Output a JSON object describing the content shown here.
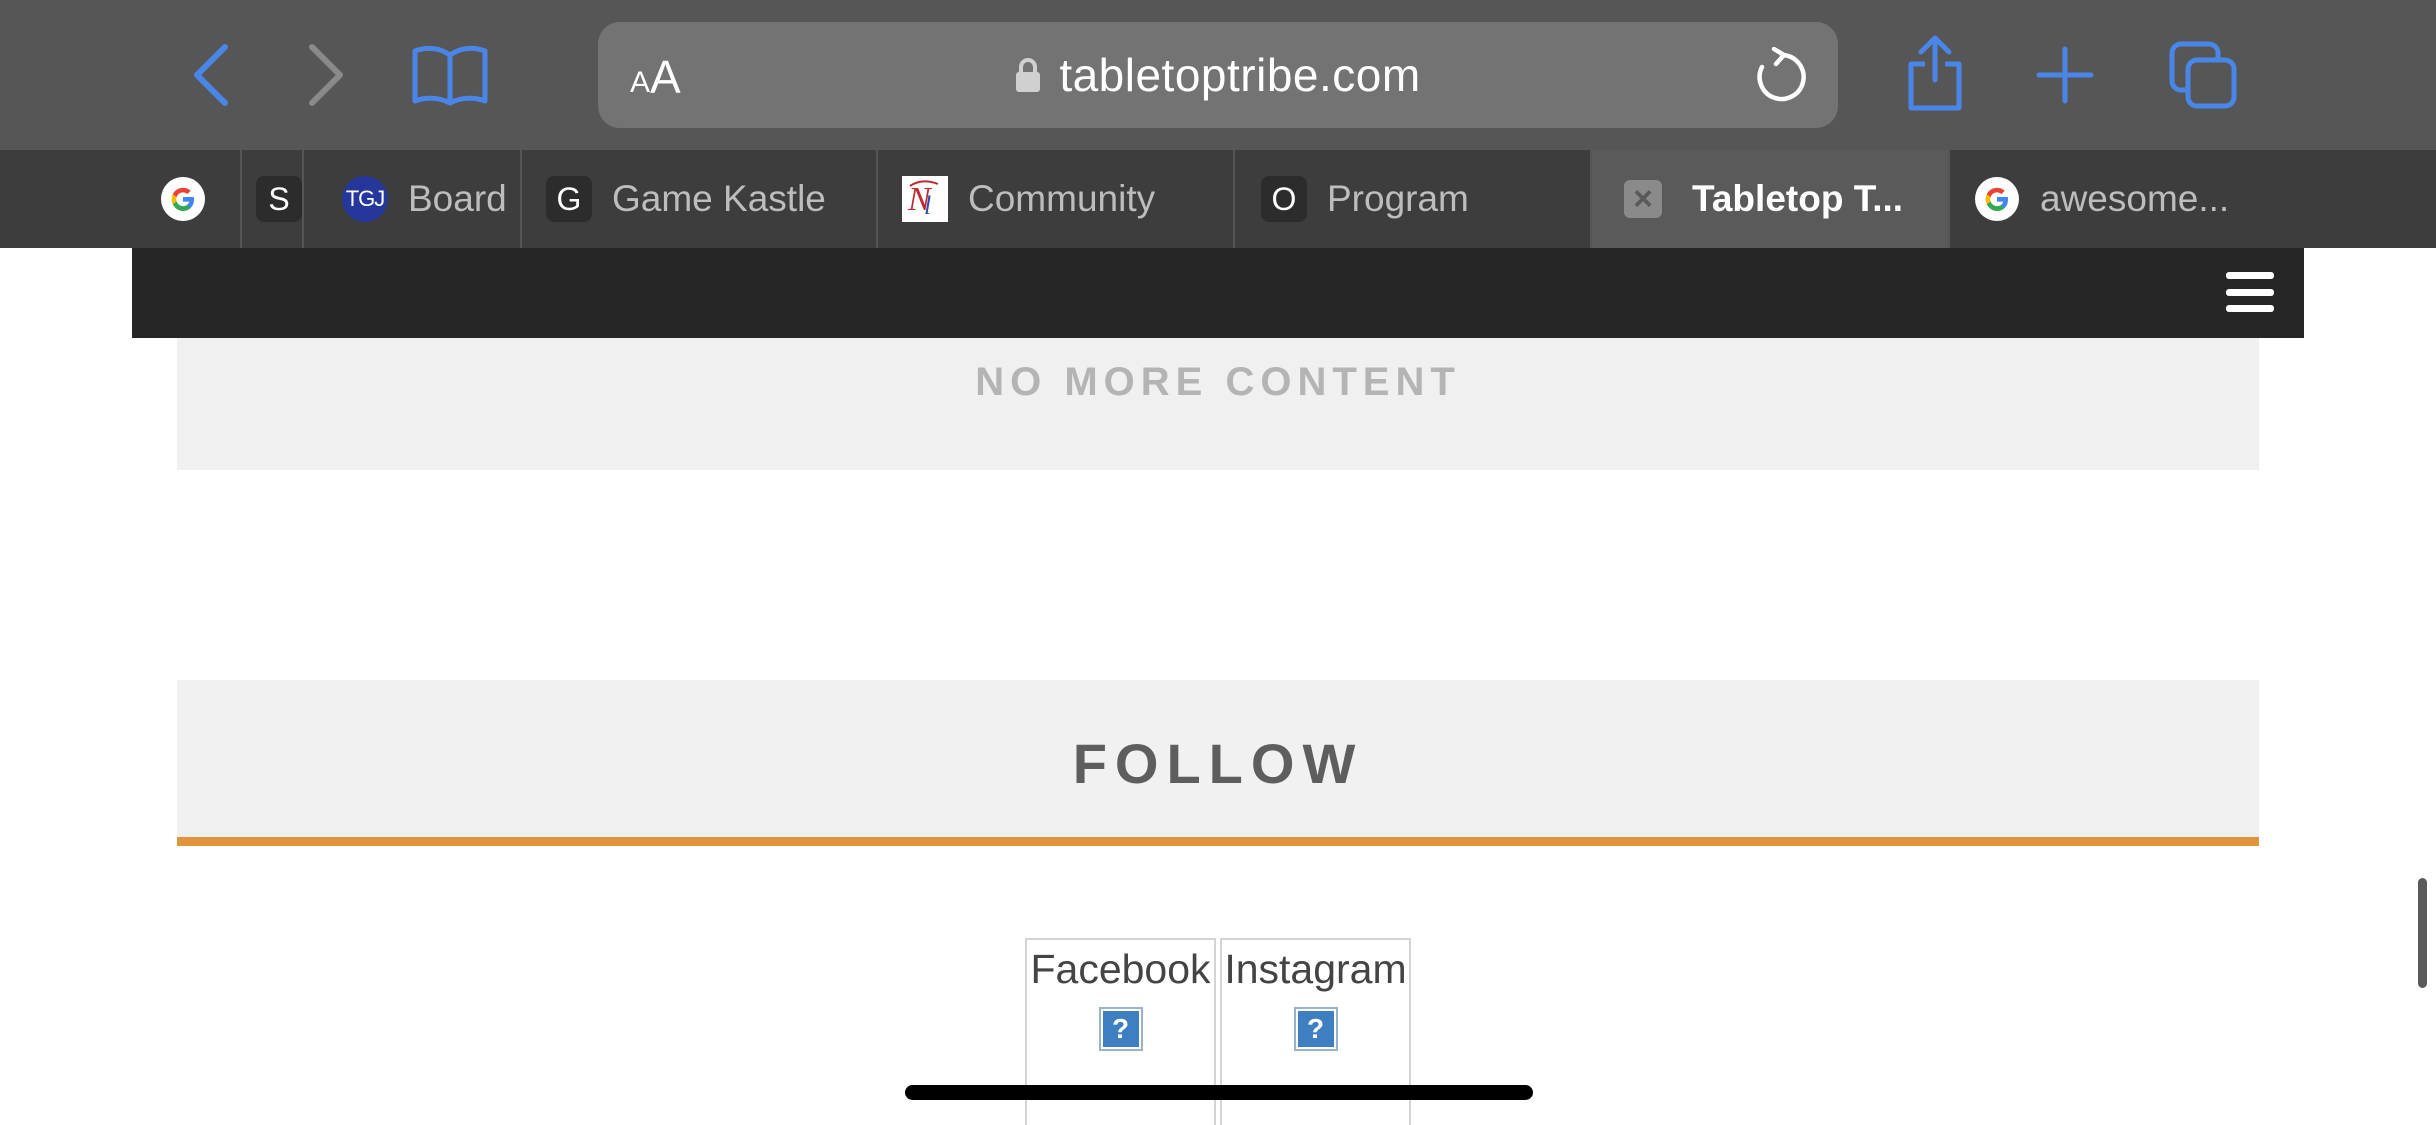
{
  "browser": {
    "address": {
      "text_size_small": "A",
      "text_size_big": "A",
      "domain": "tabletoptribe.com"
    },
    "accent_color": "#4a86e8",
    "toolbar_icons": [
      "back-arrow-icon",
      "forward-arrow-icon",
      "bookmarks-book-icon",
      "lock-icon",
      "reload-icon",
      "share-icon",
      "plus-icon",
      "tabs-overview-icon"
    ]
  },
  "tabs": [
    {
      "favicon": "google-icon",
      "label": ""
    },
    {
      "favicon": "S",
      "label": ""
    },
    {
      "favicon": "TGJ",
      "label": "Board"
    },
    {
      "favicon": "G",
      "label": "Game Kastle"
    },
    {
      "favicon": "community-logo-icon",
      "label": "Community"
    },
    {
      "favicon": "O",
      "label": "Program"
    },
    {
      "favicon": "close-icon",
      "label": "Tabletop T..."
    },
    {
      "favicon": "google-icon",
      "label": "awesome..."
    }
  ],
  "page": {
    "no_more_content": "NO MORE CONTENT",
    "follow_title": "FOLLOW",
    "follow_accent_color": "#e0943b",
    "social": [
      {
        "name": "Facebook",
        "placeholder_glyph": "?"
      },
      {
        "name": "Instagram",
        "placeholder_glyph": "?"
      }
    ]
  }
}
